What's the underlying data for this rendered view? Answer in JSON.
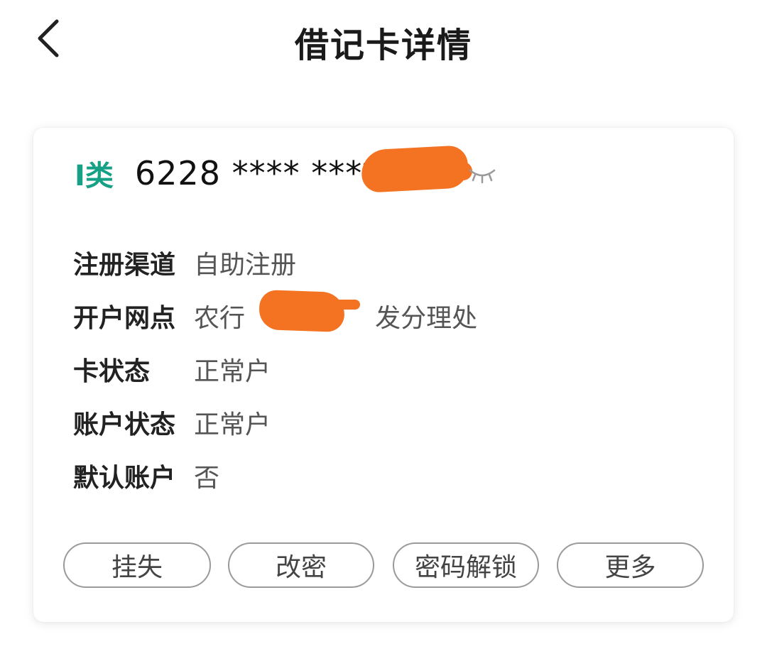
{
  "header": {
    "title": "借记卡详情",
    "back_icon": "chevron-left-icon"
  },
  "card": {
    "class_label": "I类",
    "number_visible": "6228 **** ****",
    "eye_icon": "eye-closed-icon",
    "accent_color": "#16a085"
  },
  "details": [
    {
      "label": "注册渠道",
      "value": "自助注册"
    },
    {
      "label": "开户网点",
      "value": "农行                发分理处"
    },
    {
      "label": "卡状态",
      "value": "正常户"
    },
    {
      "label": "账户状态",
      "value": "正常户"
    },
    {
      "label": "默认账户",
      "value": "否"
    }
  ],
  "actions": [
    {
      "label": "挂失"
    },
    {
      "label": "改密"
    },
    {
      "label": "密码解锁"
    },
    {
      "label": "更多"
    }
  ]
}
